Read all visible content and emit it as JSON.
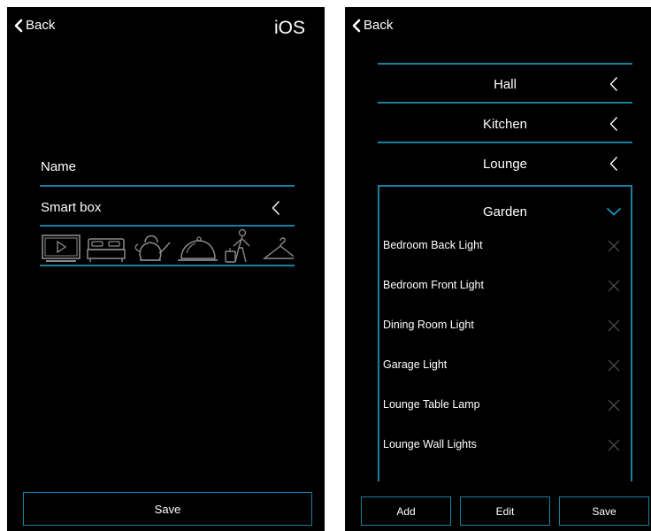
{
  "left": {
    "back_label": "Back",
    "platform_label": "iOS",
    "name_label": "Name",
    "device_type": "Smart box",
    "icons": [
      "tv-icon",
      "bed-icon",
      "kettle-icon",
      "cloche-icon",
      "traveler-icon",
      "hanger-icon"
    ],
    "save_label": "Save"
  },
  "right": {
    "back_label": "Back",
    "rooms": [
      {
        "label": "Hall"
      },
      {
        "label": "Kitchen"
      },
      {
        "label": "Lounge"
      }
    ],
    "expanded_room": {
      "label": "Garden",
      "devices": [
        {
          "label": "Bedroom Back Light"
        },
        {
          "label": "Bedroom Front Light"
        },
        {
          "label": "Dining Room Light"
        },
        {
          "label": "Garage Light"
        },
        {
          "label": "Lounge Table Lamp"
        },
        {
          "label": "Lounge Wall Lights"
        }
      ]
    },
    "buttons": {
      "add": "Add",
      "edit": "Edit",
      "save": "Save"
    }
  },
  "colors": {
    "accent": "#1a7fa0",
    "background": "#000000",
    "text": "#ffffff",
    "icon_gray": "#8a8a8a"
  }
}
